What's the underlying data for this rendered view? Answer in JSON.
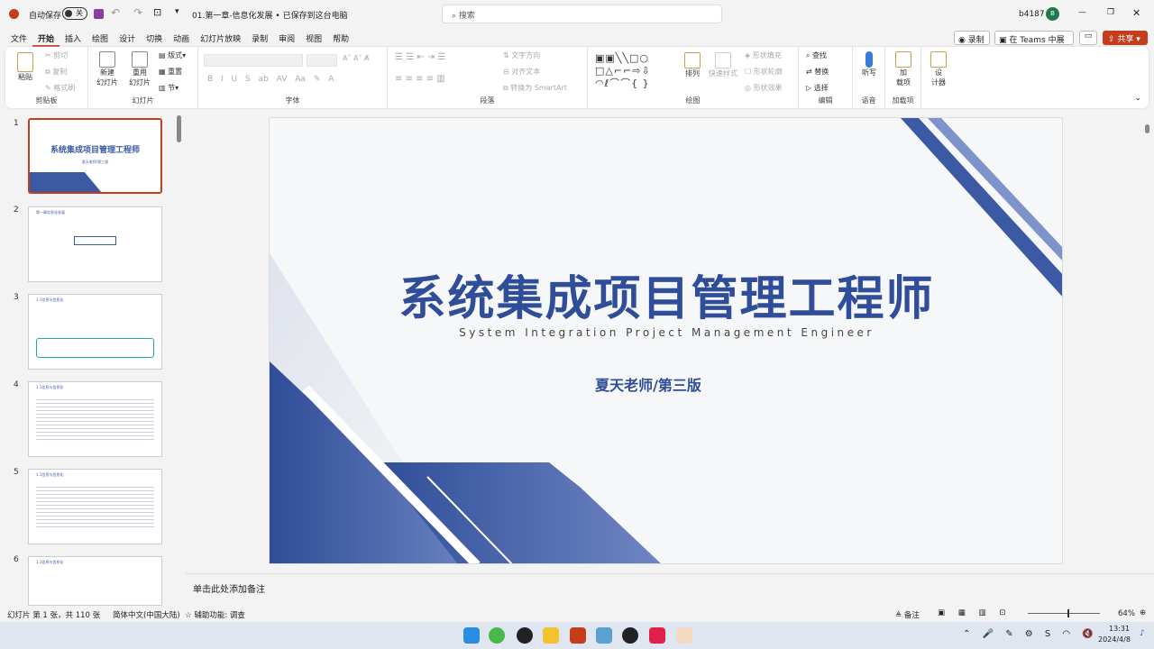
{
  "titlebar": {
    "autosave_label": "自动保存",
    "autosave_state": "关",
    "doc_title": "01.第一章-信息化发展 • 已保存到这台电脑",
    "search_placeholder": "搜索",
    "user": "b4187",
    "avatar_letter": "B"
  },
  "tabs": [
    "文件",
    "开始",
    "插入",
    "绘图",
    "设计",
    "切换",
    "动画",
    "幻灯片放映",
    "录制",
    "审阅",
    "视图",
    "帮助"
  ],
  "actions": {
    "record": "录制",
    "teams": "在 Teams 中展示",
    "share": "共享"
  },
  "ribbon": {
    "clipboard": {
      "label": "剪贴板",
      "paste": "粘贴",
      "cut": "剪切",
      "copy": "复制",
      "format_painter": "格式刷"
    },
    "slides": {
      "label": "幻灯片",
      "new_slide": "新建\n幻灯片",
      "reuse": "重用\n幻灯片",
      "layout": "版式",
      "reset": "重置",
      "section": "节"
    },
    "font": {
      "label": "字体"
    },
    "paragraph": {
      "label": "段落",
      "text_direction": "文字方向",
      "align_text": "对齐文本",
      "smartart": "转换为 SmartArt"
    },
    "drawing": {
      "label": "绘图",
      "arrange": "排列",
      "quick_styles": "快速样式",
      "fill": "形状填充",
      "outline": "形状轮廓",
      "effects": "形状效果"
    },
    "editing": {
      "label": "编辑",
      "find": "查找",
      "replace": "替换",
      "select": "选择"
    },
    "voice": {
      "label": "语音",
      "dictate": "听写"
    },
    "addins": {
      "label": "加载项",
      "addins_btn": "加\n载项"
    },
    "designer": {
      "label": "设\n计器"
    }
  },
  "thumbnails": [
    {
      "num": "1",
      "title": "系统集成项目管理工程师",
      "sub": "夏天老师/第三版"
    },
    {
      "num": "2",
      "title": "第一章信息化发展"
    },
    {
      "num": "3",
      "title": "1.1信息与信息化"
    },
    {
      "num": "4",
      "title": "1.1信息与信息化"
    },
    {
      "num": "5",
      "title": "1.1信息与信息化"
    },
    {
      "num": "6",
      "title": "1.1信息与信息化"
    }
  ],
  "slide": {
    "title": "系统集成项目管理工程师",
    "subtitle": "System Integration Project Management Engineer",
    "author": "夏天老师/第三版",
    "accent": "#3b5aa3"
  },
  "notes_placeholder": "单击此处添加备注",
  "status": {
    "slide_count": "幻灯片 第 1 张，共 110 张",
    "language": "简体中文(中国大陆)",
    "accessibility": "辅助功能: 调查",
    "notes_btn": "备注",
    "zoom": "64%"
  },
  "taskbar": {
    "time": "13:31",
    "date": "2024/4/8"
  }
}
